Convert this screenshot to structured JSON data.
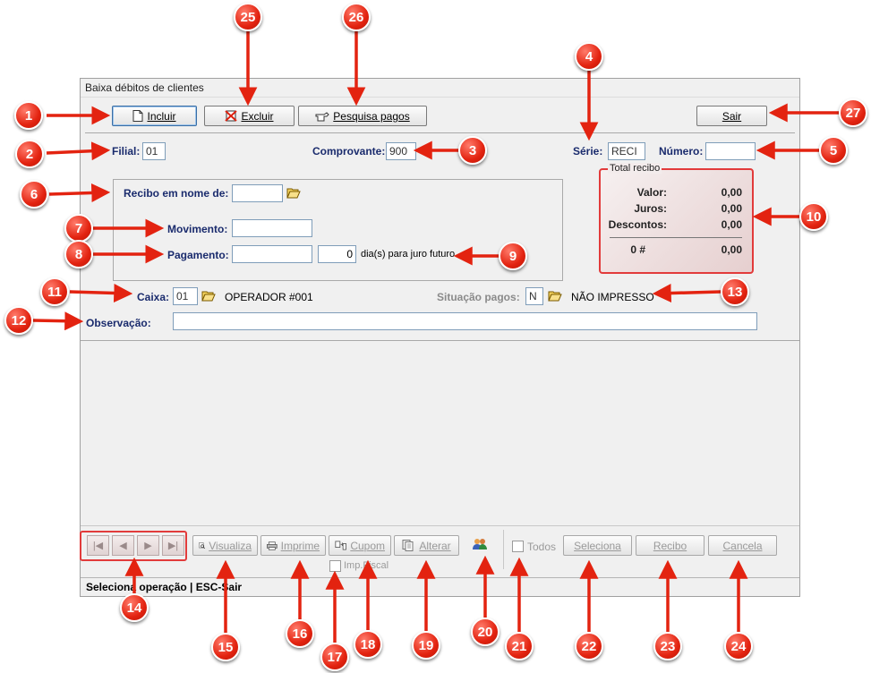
{
  "window": {
    "title": "Baixa débitos de clientes"
  },
  "toolbar": {
    "incluir": "Incluir",
    "excluir": "Excluir",
    "pesquisa": "Pesquisa pagos",
    "sair": "Sair"
  },
  "header": {
    "filial_label": "Filial:",
    "filial_value": "01",
    "comprovante_label": "Comprovante:",
    "comprovante_value": "900",
    "serie_label": "Série:",
    "serie_value": "RECI",
    "numero_label": "Número:",
    "numero_value": ""
  },
  "form": {
    "recibo_label": "Recibo em nome de:",
    "recibo_value": "",
    "movimento_label": "Movimento:",
    "movimento_value": "",
    "pagamento_label": "Pagamento:",
    "pagamento_value": "",
    "dias_value": "0",
    "dias_suffix": "dia(s) para juro futuro."
  },
  "total": {
    "legend": "Total recibo",
    "rows": [
      {
        "label": "Valor:",
        "value": "0,00"
      },
      {
        "label": "Juros:",
        "value": "0,00"
      },
      {
        "label": "Descontos:",
        "value": "0,00"
      }
    ],
    "count_label": "0 #",
    "total_value": "0,00"
  },
  "caixa": {
    "label": "Caixa:",
    "value": "01",
    "operator": "OPERADOR #001",
    "situacao_label": "Situação pagos:",
    "situacao_value": "N",
    "situacao_text": "NÃO IMPRESSO"
  },
  "observacao": {
    "label": "Observação:",
    "value": ""
  },
  "bottom": {
    "visualiza": "Visualiza",
    "imprime": "Imprime",
    "cupom": "Cupom",
    "alterar": "Alterar",
    "imp_fiscal": "Imp.Fiscal",
    "todos": "Todos",
    "seleciona": "Seleciona",
    "recibo": "Recibo",
    "cancela": "Cancela"
  },
  "status": {
    "text": "Seleciona operação  |  ESC-Sair"
  },
  "callouts": [
    "1",
    "2",
    "3",
    "4",
    "5",
    "6",
    "7",
    "8",
    "9",
    "10",
    "11",
    "12",
    "13",
    "14",
    "15",
    "16",
    "17",
    "18",
    "19",
    "20",
    "21",
    "22",
    "23",
    "24",
    "25",
    "26",
    "27"
  ],
  "colors": {
    "callout": "#e32310",
    "label_blue": "#1a2b6d"
  }
}
